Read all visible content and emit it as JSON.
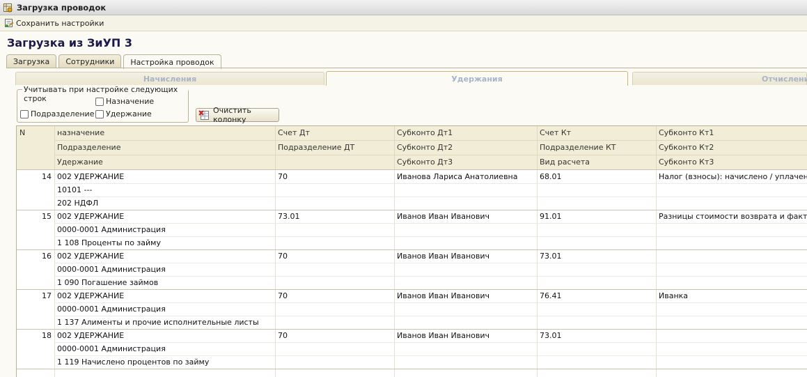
{
  "window": {
    "title": "Загрузка проводок"
  },
  "toolbar": {
    "save_label": "Сохранить настройки"
  },
  "heading": "Загрузка из ЗиУП 3",
  "tabs": [
    {
      "label": "Загрузка",
      "active": false
    },
    {
      "label": "Сотрудники",
      "active": false
    },
    {
      "label": "Настройка проводок",
      "active": true
    }
  ],
  "subtabs": [
    {
      "label": "Начисления",
      "active": false
    },
    {
      "label": "Удержания",
      "active": true
    },
    {
      "label": "Отчисления",
      "active": false
    }
  ],
  "filter_group": {
    "legend": "Учитывать при настройке следующих строк",
    "checkboxes": [
      {
        "label": "Назначение",
        "checked": false
      },
      {
        "label": "Подразделение",
        "checked": false
      },
      {
        "label": "Удержание",
        "checked": false
      }
    ]
  },
  "clear_button": "Очистить колонку",
  "table": {
    "header": {
      "n": "N",
      "col1": [
        "назначение",
        "Подразделение",
        "Удержание"
      ],
      "col2": [
        "Счет Дт",
        "Подразделение ДТ",
        ""
      ],
      "col3": [
        "Субконто Дт1",
        "Субконто Дт2",
        "Субконто Дт3"
      ],
      "col4": [
        "Счет Кт",
        "Подразделение КТ",
        "Вид расчета"
      ],
      "col5": [
        "Субконто Кт1",
        "Субконто Кт2",
        "Субконто Кт3"
      ]
    },
    "rows": [
      {
        "n": "14",
        "c1": [
          "002 УДЕРЖАНИЕ",
          "10101 ---",
          "202 НДФЛ"
        ],
        "c2": [
          "70",
          "",
          ""
        ],
        "c3": [
          "Иванова Лариса Анатолиевна",
          "",
          ""
        ],
        "c4": [
          "68.01",
          "",
          ""
        ],
        "c5": [
          "Налог (взносы): начислено / уплачено",
          "",
          ""
        ]
      },
      {
        "n": "15",
        "c1": [
          "002 УДЕРЖАНИЕ",
          "0000-0001 Администрация",
          "1 108 Проценты по займу"
        ],
        "c2": [
          "73.01",
          "",
          ""
        ],
        "c3": [
          "Иванов Иван Иванович",
          "",
          ""
        ],
        "c4": [
          "91.01",
          "",
          ""
        ],
        "c5": [
          "Разницы стоимости возврата и факти...",
          "",
          ""
        ]
      },
      {
        "n": "16",
        "c1": [
          "002 УДЕРЖАНИЕ",
          "0000-0001 Администрация",
          "1 090 Погашение займов"
        ],
        "c2": [
          "70",
          "",
          ""
        ],
        "c3": [
          "Иванов Иван Иванович",
          "",
          ""
        ],
        "c4": [
          "73.01",
          "",
          ""
        ],
        "c5": [
          "",
          "",
          ""
        ]
      },
      {
        "n": "17",
        "c1": [
          "002 УДЕРЖАНИЕ",
          "0000-0001 Администрация",
          "1 137 Алименты и прочие исполнительные листы"
        ],
        "c2": [
          "70",
          "",
          ""
        ],
        "c3": [
          "Иванов Иван Иванович",
          "",
          ""
        ],
        "c4": [
          "76.41",
          "",
          ""
        ],
        "c5": [
          "Иванка",
          "",
          ""
        ]
      },
      {
        "n": "18",
        "c1": [
          "002 УДЕРЖАНИЕ",
          "0000-0001 Администрация",
          "1 119 Начислено процентов по займу"
        ],
        "c2": [
          "70",
          "",
          ""
        ],
        "c3": [
          "Иванов Иван Иванович",
          "",
          ""
        ],
        "c4": [
          "73.01",
          "",
          ""
        ],
        "c5": [
          "",
          "",
          ""
        ]
      }
    ]
  }
}
